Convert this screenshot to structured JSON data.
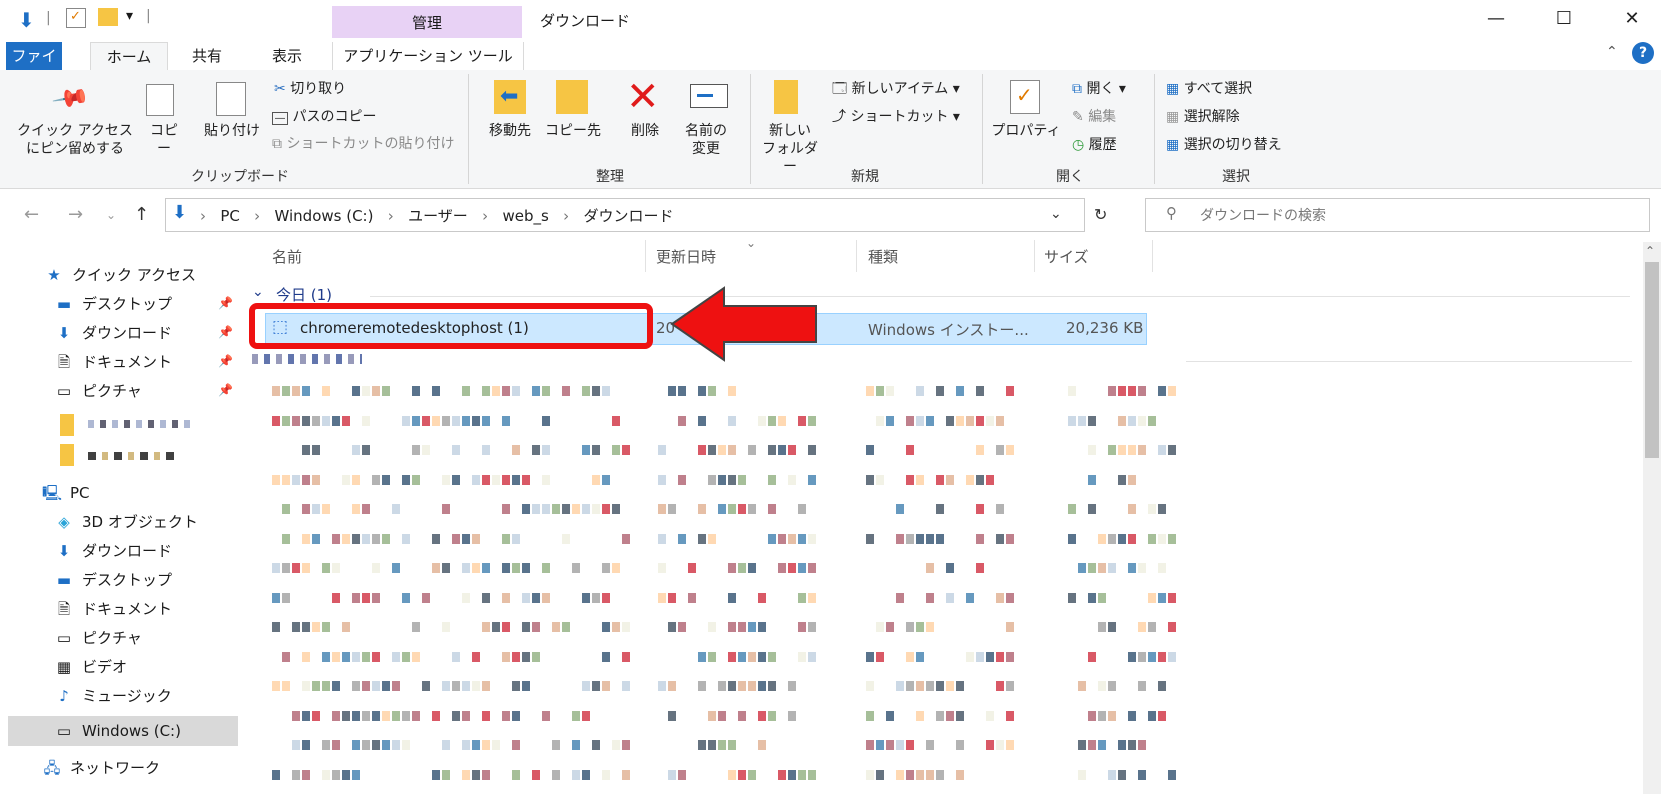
{
  "titlebar": {
    "context_group": "管理",
    "window_title": "ダウンロード",
    "qat_dropdown": "▾"
  },
  "tabs": {
    "file": "ファイル",
    "home": "ホーム",
    "share": "共有",
    "view": "表示",
    "app_tools": "アプリケーション ツール"
  },
  "ribbon": {
    "clipboard": {
      "pin": "クイック アクセス\nにピン留めする",
      "copy": "コピー",
      "paste": "貼り付け",
      "cut": "切り取り",
      "copy_path": "パスのコピー",
      "paste_shortcut": "ショートカットの貼り付け",
      "group": "クリップボード"
    },
    "organize": {
      "move_to": "移動先",
      "copy_to": "コピー先",
      "delete": "削除",
      "rename": "名前の\n変更",
      "group": "整理"
    },
    "new": {
      "new_folder": "新しい\nフォルダー",
      "new_item": "新しいアイテム ▾",
      "shortcut": "ショートカット ▾",
      "group": "新規"
    },
    "open": {
      "properties": "プロパティ",
      "open": "開く ▾",
      "edit": "編集",
      "history": "履歴",
      "group": "開く"
    },
    "select": {
      "select_all": "すべて選択",
      "select_none": "選択解除",
      "invert": "選択の切り替え",
      "group": "選択"
    }
  },
  "address": {
    "crumbs": [
      "PC",
      "Windows (C:)",
      "ユーザー",
      "web_s",
      "ダウンロード"
    ],
    "search_placeholder": "ダウンロードの検索"
  },
  "nav": {
    "quick_access": "クイック アクセス",
    "desktop": "デスクトップ",
    "downloads": "ダウンロード",
    "documents": "ドキュメント",
    "pictures": "ピクチャ",
    "pc": "PC",
    "objects3d": "3D オブジェクト",
    "pc_downloads": "ダウンロード",
    "pc_desktop": "デスクトップ",
    "pc_documents": "ドキュメント",
    "pc_pictures": "ピクチャ",
    "videos": "ビデオ",
    "music": "ミュージック",
    "drive_c": "Windows (C:)",
    "network": "ネットワーク"
  },
  "columns": {
    "name": "名前",
    "modified": "更新日時",
    "type": "種類",
    "size": "サイズ"
  },
  "group_today": "今日 (1)",
  "file": {
    "name": "chromeremotedesktophost (1)",
    "date_fragment": "20",
    "type": "Windows インストー...",
    "size": "20,236 KB"
  },
  "colors": {
    "accent": "#1e6fc5",
    "selection": "#cce8ff",
    "highlight_red": "#ee1111",
    "context_tab": "#e8d2f5"
  }
}
